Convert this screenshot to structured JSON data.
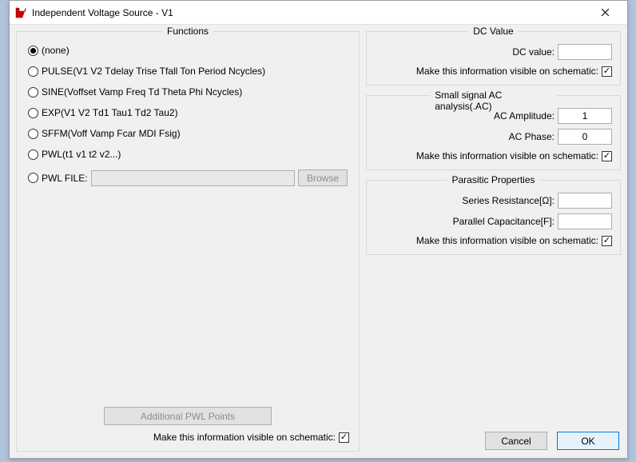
{
  "window": {
    "title": "Independent Voltage Source - V1"
  },
  "left": {
    "legend": "Functions",
    "options": {
      "none": "(none)",
      "pulse": "PULSE(V1 V2 Tdelay Trise Tfall Ton Period Ncycles)",
      "sine": "SINE(Voffset Vamp Freq Td Theta Phi Ncycles)",
      "exp": "EXP(V1 V2 Td1 Tau1 Td2 Tau2)",
      "sffm": "SFFM(Voff Vamp Fcar MDI Fsig)",
      "pwl": "PWL(t1 v1 t2 v2...)",
      "pwlfile": "PWL FILE:"
    },
    "browse": "Browse",
    "additional_pwl": "Additional PWL Points",
    "visible_label": "Make this information visible on schematic:"
  },
  "dc": {
    "legend": "DC Value",
    "dc_value_label": "DC value:",
    "dc_value": "",
    "visible_label": "Make this information visible on schematic:"
  },
  "ac": {
    "legend": "Small signal AC analysis(.AC)",
    "amp_label": "AC Amplitude:",
    "amp_value": "1",
    "phase_label": "AC Phase:",
    "phase_value": "0",
    "visible_label": "Make this information visible on schematic:"
  },
  "parasitic": {
    "legend": "Parasitic Properties",
    "series_label": "Series Resistance[Ω]:",
    "series_value": "",
    "parallel_label": "Parallel Capacitance[F]:",
    "parallel_value": "",
    "visible_label": "Make this information visible on schematic:"
  },
  "buttons": {
    "cancel": "Cancel",
    "ok": "OK"
  }
}
